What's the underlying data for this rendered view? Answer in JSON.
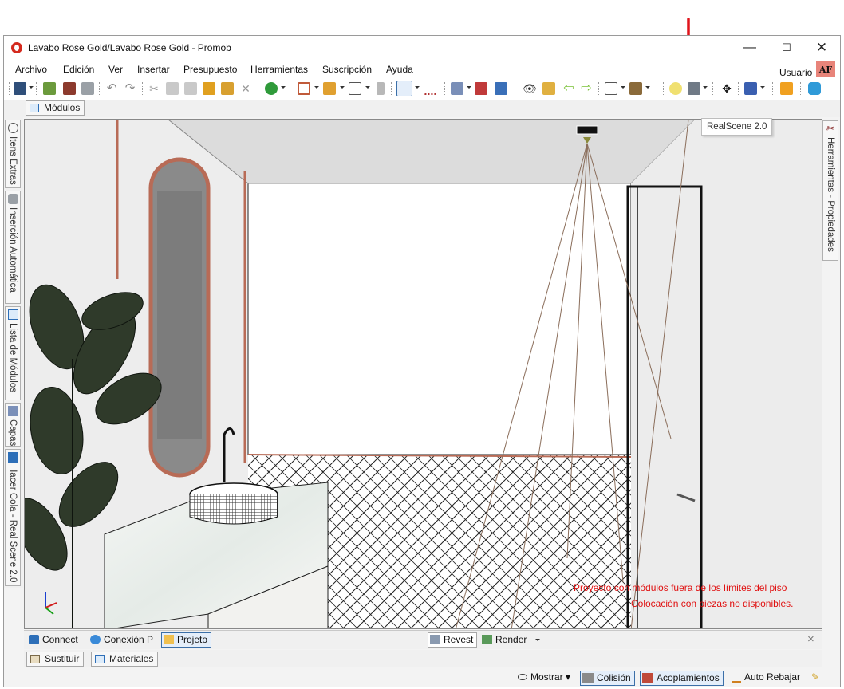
{
  "window": {
    "title": "Lavabo Rose Gold/Lavabo Rose Gold - Promob",
    "minimize_symbol": "—",
    "maximize_symbol": "☐",
    "close_symbol": "✕"
  },
  "menu": {
    "items": [
      "Archivo",
      "Edición",
      "Ver",
      "Insertar",
      "Presupuesto",
      "Herramientas",
      "Suscripción",
      "Ayuda"
    ]
  },
  "user": {
    "label": "Usuario",
    "initials": "AF"
  },
  "toolbar": {
    "icons": [
      "save-icon",
      "undo-icon",
      "redo-icon",
      "cut-icon",
      "copy-icon",
      "paste-icon",
      "budget-icon",
      "select-icon",
      "layers-icon",
      "3d-view-icon",
      "eye-icon",
      "arrow-left-icon",
      "arrow-right-icon",
      "box-icon",
      "lightbulb-icon",
      "realscene-camera-icon",
      "move-icon",
      "palette-icon",
      "user-icon",
      "chat-icon"
    ],
    "tooltip": "RealScene 2.0"
  },
  "tabs_top": {
    "modulos": "Módulos"
  },
  "left_rail": {
    "items": [
      "Itens Extras",
      "Inserción Automática",
      "Lista de Módulos",
      "Capas",
      "Hacer Cola - Real Scene 2.0"
    ]
  },
  "right_rail": {
    "label": "Herramientas - Propiedades"
  },
  "viewport": {
    "warnings": [
      "Proyecto con módulos fuera de los límites del piso",
      "Colocación con piezas no disponibles."
    ]
  },
  "bottom_panel": {
    "connect": "Connect",
    "conexion": "Conexión P",
    "projeto": "Projeto",
    "revest": "Revest",
    "render": "Render",
    "close": "×"
  },
  "tabs_bottom": {
    "sustituir": "Sustituir",
    "materiales": "Materiales"
  },
  "statusbar": {
    "mostrar": "Mostrar",
    "colision": "Colisión",
    "acoplamientos": "Acoplamientos",
    "auto_rebajar": "Auto Rebajar"
  },
  "colors": {
    "annotation_arrow": "#e0141b",
    "warning_text": "#e01010",
    "rose_gold": "#b86b56",
    "user_badge": "#e8847a"
  }
}
